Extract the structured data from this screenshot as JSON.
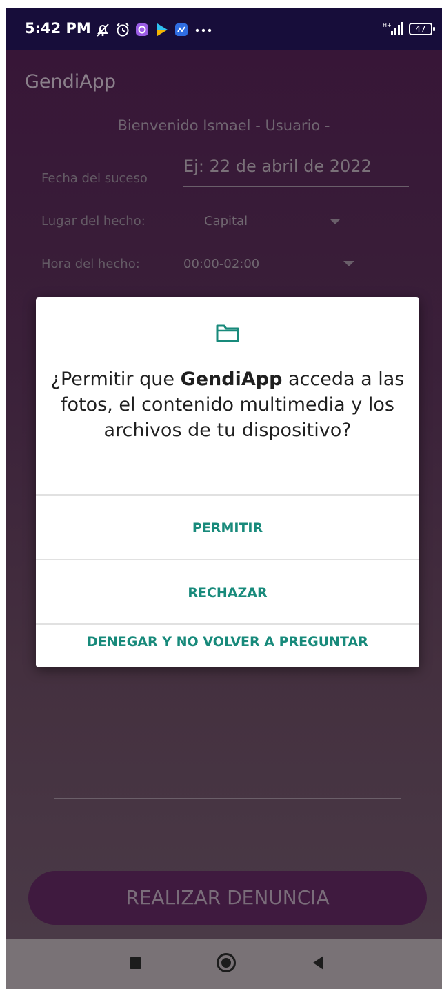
{
  "status_bar": {
    "time": "5:42 PM",
    "battery": "47",
    "icons": [
      "notifications-off-icon",
      "alarm-icon",
      "app-notification-icon",
      "play-store-icon",
      "message-icon",
      "more-notifications-icon",
      "signal-icon",
      "battery-icon"
    ]
  },
  "app": {
    "title": "GendiApp",
    "welcome": "Bienvenido Ismael - Usuario -",
    "date_label": "Fecha del suceso",
    "date_placeholder": "Ej: 22 de abril de 2022",
    "place_label": "Lugar del hecho:",
    "place_value": "Capital",
    "time_label": "Hora del hecho:",
    "time_value": "00:00-02:00",
    "submit_label": "REALIZAR DENUNCIA"
  },
  "dialog": {
    "icon": "folder-icon",
    "message_prefix": "¿Permitir que ",
    "message_app": "GendiApp",
    "message_suffix": " acceda a las fotos, el contenido multimedia y los archivos de tu dispositivo?",
    "allow_label": "PERMITIR",
    "deny_label": "RECHAZAR",
    "deny_forever_label": "DENEGAR Y NO VOLVER A PREGUNTAR",
    "accent_color": "#188a7b"
  },
  "nav_bar": {
    "icons": [
      "recents-square-icon",
      "home-circle-icon",
      "back-triangle-icon"
    ]
  }
}
